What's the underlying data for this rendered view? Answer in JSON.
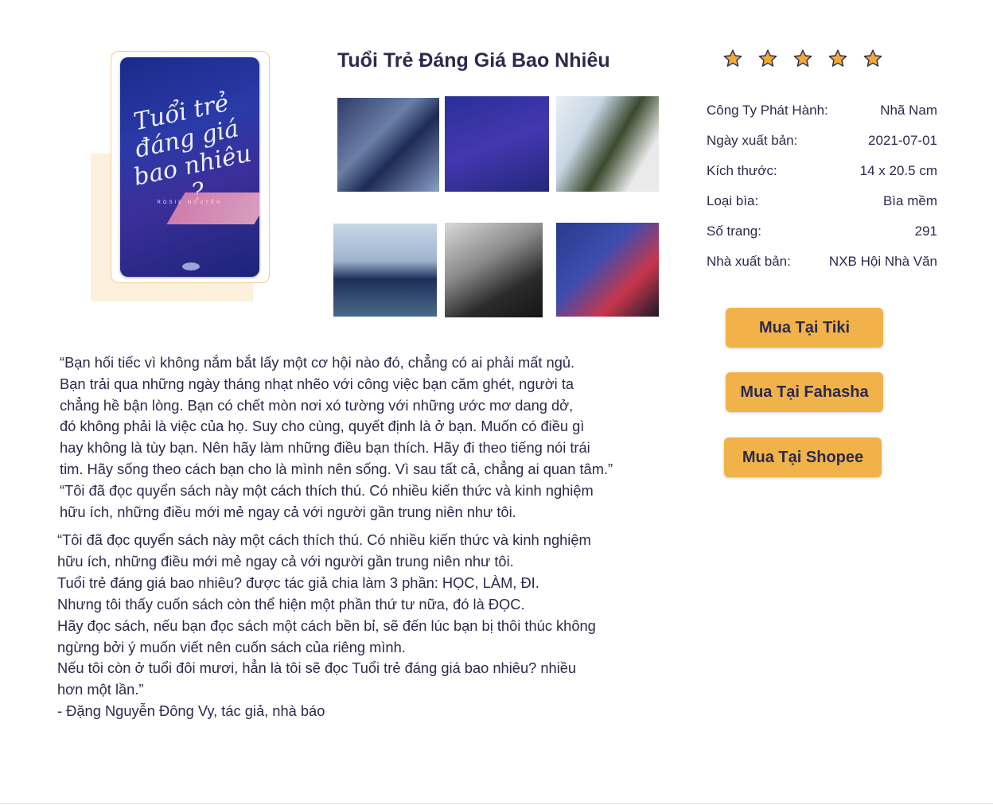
{
  "book": {
    "title": "Tuổi Trẻ Đáng Giá Bao Nhiêu",
    "cover_title_lines": [
      "Tuổi trẻ",
      "đáng giá",
      "bao nhiêu",
      "?"
    ],
    "cover_author": "ROSIE NGUYỄN",
    "rating": {
      "value": 5,
      "max": 5
    }
  },
  "info": [
    {
      "label": "Công Ty Phát Hành:",
      "value": "Nhã Nam"
    },
    {
      "label": "Ngày xuất bản:",
      "value": "2021-07-01"
    },
    {
      "label": "Kích thước:",
      "value": "14 x 20.5 cm"
    },
    {
      "label": "Loại bìa:",
      "value": "Bìa mềm"
    },
    {
      "label": "Số trang:",
      "value": "291"
    },
    {
      "label": "Nhà xuất bản:",
      "value": "NXB Hội Nhà Văn"
    }
  ],
  "buttons": {
    "tiki": "Mua Tại Tiki",
    "fahasha": "Mua Tại Fahasha",
    "shopee": "Mua Tại Shopee"
  },
  "description_1": [
    "“Bạn hối tiếc vì không nắm bắt lấy một cơ hội nào đó, chẳng có ai phải mất ngủ.",
    "Bạn trải qua những ngày tháng nhạt nhẽo với công việc bạn căm ghét, người ta",
    "chẳng hề bận lòng. Bạn có chết mòn nơi xó tường với những ước mơ dang dở,",
    "đó không phải là việc của họ. Suy cho cùng, quyết định là ở bạn. Muốn có điều gì",
    "hay không là tùy bạn. Nên hãy làm những điều bạn thích. Hãy đi theo tiếng nói trái",
    "tim. Hãy sống theo cách bạn cho là mình nên sống. Vì sau tất cả, chẳng ai quan tâm.”",
    "“Tôi đã đọc quyển sách này một cách thích thú. Có nhiều kiến thức và kinh nghiệm",
    "hữu ích, những điều mới mẻ ngay cả với người gần trung niên như tôi."
  ],
  "description_2": [
    "“Tôi đã đọc quyển sách này một cách thích thú. Có nhiều kiến thức và kinh nghiệm",
    "hữu ích, những điều mới mẻ ngay cả với người gần trung niên như tôi.",
    "Tuổi trẻ đáng giá bao nhiêu? được tác giả chia làm 3 phần: HỌC, LÀM, ĐI.",
    "Nhưng tôi thấy cuốn sách còn thể hiện một phần thứ tư nữa, đó là ĐỌC.",
    "Hãy đọc sách, nếu bạn đọc sách một cách bền bỉ, sẽ đến lúc bạn bị thôi thúc không",
    "ngừng bởi ý muốn viết nên cuốn sách của riêng mình.",
    "Nếu tôi còn ở tuổi đôi mươi, hẳn là tôi sẽ đọc Tuổi trẻ đáng giá bao nhiêu? nhiều",
    "hơn một lần.”",
    "- Đặng Nguyễn Đông Vy, tác giả, nhà báo"
  ],
  "colors": {
    "accent": "#f1b349",
    "text": "#2b2a4c",
    "star": "#f0a93a"
  },
  "icons": {
    "star": "star-icon"
  }
}
